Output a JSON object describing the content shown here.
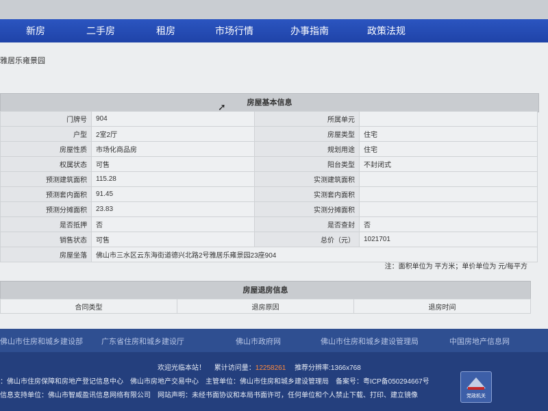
{
  "nav": {
    "items": [
      "新房",
      "二手房",
      "租房",
      "市场行情",
      "办事指南",
      "政策法规"
    ],
    "bg_color": "#2147b0"
  },
  "breadcrumb": "雅居乐雍景园",
  "basic_info": {
    "title": "房屋基本信息",
    "rows": [
      {
        "l1": "门牌号",
        "v1": "904",
        "l2": "所属单元",
        "v2": ""
      },
      {
        "l1": "户型",
        "v1": "2室2厅",
        "l2": "房屋类型",
        "v2": "住宅"
      },
      {
        "l1": "房屋性质",
        "v1": "市场化商品房",
        "l2": "规划用途",
        "v2": "住宅"
      },
      {
        "l1": "权属状态",
        "v1": "可售",
        "l2": "阳台类型",
        "v2": "不封闭式"
      },
      {
        "l1": "预测建筑面积",
        "v1": "115.28",
        "l2": "实测建筑面积",
        "v2": ""
      },
      {
        "l1": "预测套内面积",
        "v1": "91.45",
        "l2": "实测套内面积",
        "v2": ""
      },
      {
        "l1": "预测分摊面积",
        "v1": "23.83",
        "l2": "实测分摊面积",
        "v2": ""
      },
      {
        "l1": "是否抵押",
        "v1": "否",
        "l2": "是否查封",
        "v2": "否"
      },
      {
        "l1": "销售状态",
        "v1": "可售",
        "l2": "总价（元）",
        "v2": "1021701"
      }
    ],
    "address_label": "房屋坐落",
    "address_value": "佛山市三水区云东海街道德兴北路2号雅居乐雍景园23座904",
    "unit_note": "注：面积单位为 平方米；单价单位为 元/每平方"
  },
  "refund_info": {
    "title": "房屋退房信息",
    "columns": [
      "合同类型",
      "退房原因",
      "退房时间"
    ]
  },
  "footer_links": [
    "佛山市住房和城乡建设部",
    "广东省住房和城乡建设厅",
    "佛山市政府网",
    "佛山市住房和城乡建设管理局",
    "中国房地产信息网"
  ],
  "footer": {
    "welcome": "欢迎光临本站！",
    "visits_label": "累计访问量：",
    "visits_value": "12258261",
    "resolution": "推荐分辨率:1366x768",
    "line2": "：佛山市住房保障和房地产登记信息中心　佛山市房地产交易中心　主管单位：佛山市住房和城乡建设管理局　备案号：粤ICP备050294667号",
    "line3": "信息支持单位：佛山市智威盈讯信息网络有限公司　网站声明：未经书面协议和本局书面许可，任何单位和个人禁止下载、打印、建立镜像",
    "seal_text": "党政机关"
  },
  "colors": {
    "nav": "#2147b0",
    "footer_links_bg": "#2f4f91",
    "footer_bg": "#243f7d",
    "visit_count": "#ff8a3d"
  }
}
